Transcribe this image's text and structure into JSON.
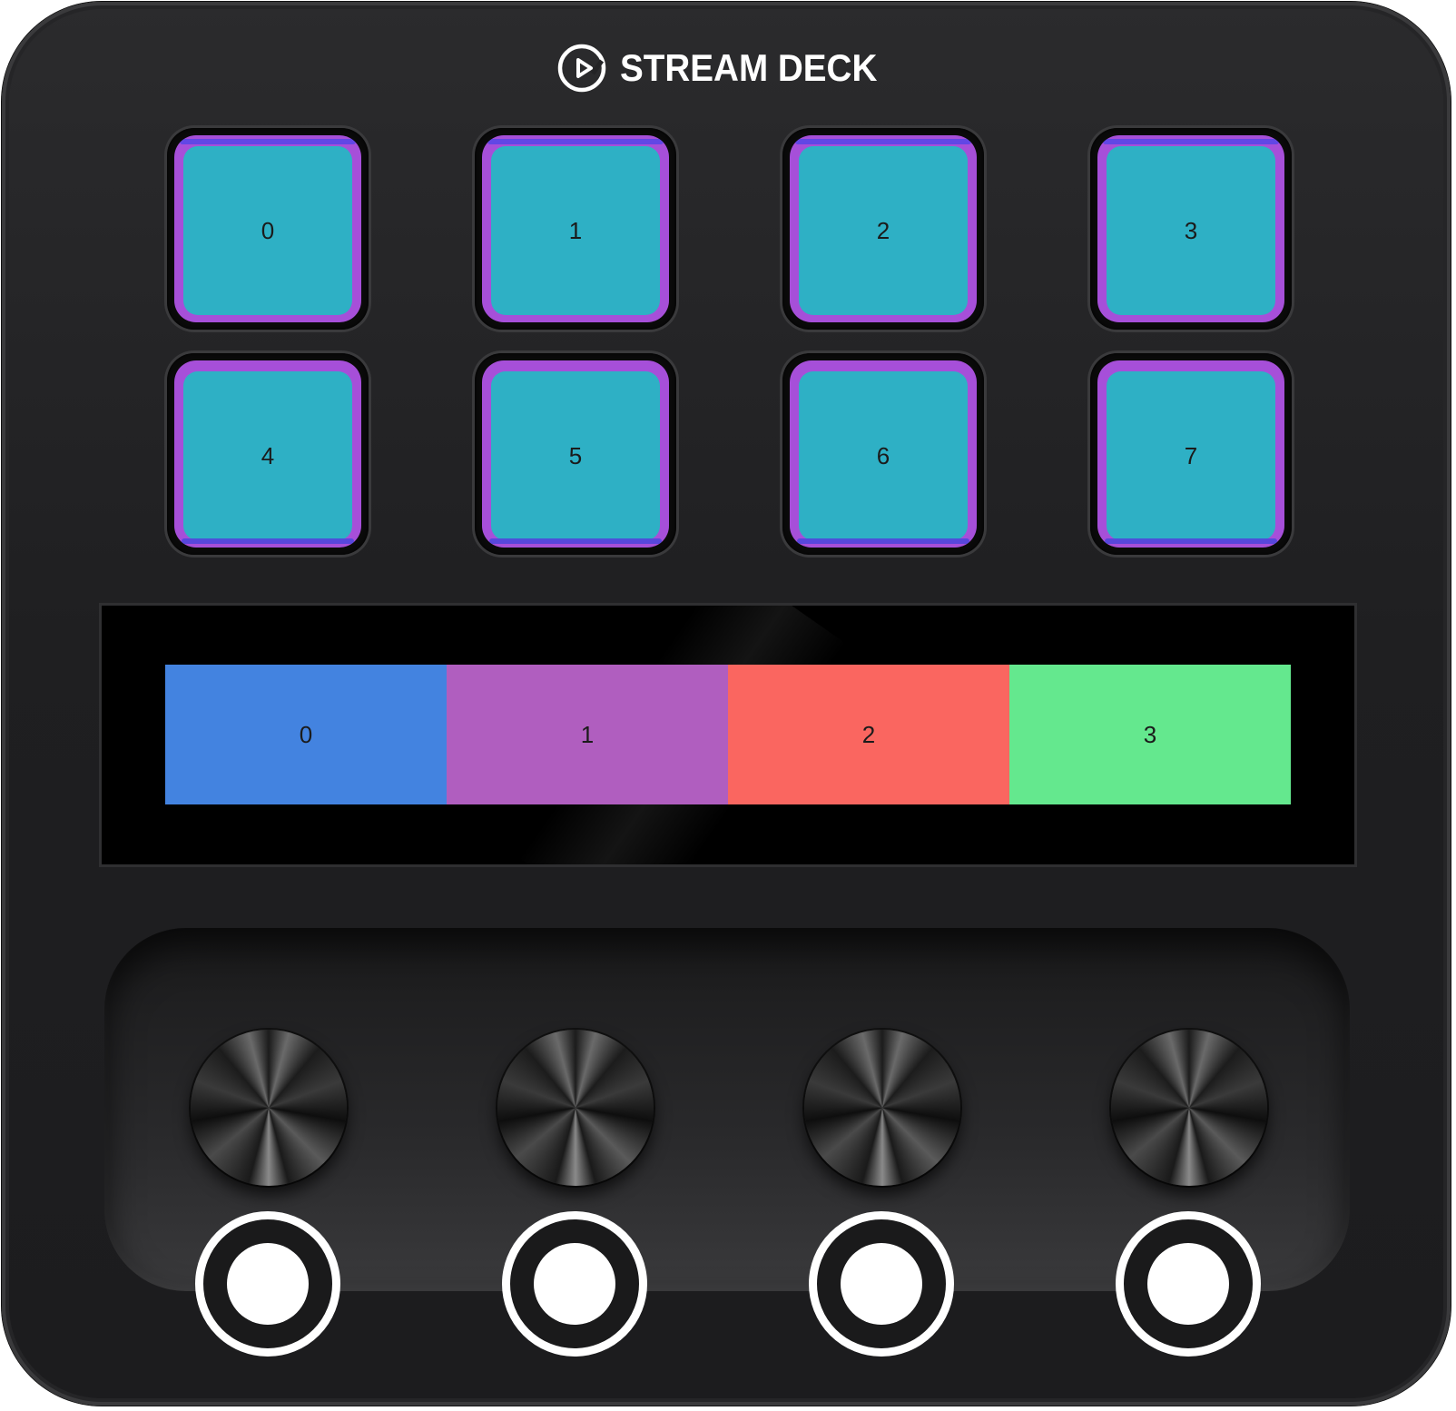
{
  "brand": {
    "name": "STREAM DECK",
    "logo_icon": "elgato-logo-icon"
  },
  "keys": [
    {
      "label": "0"
    },
    {
      "label": "1"
    },
    {
      "label": "2"
    },
    {
      "label": "3"
    },
    {
      "label": "4"
    },
    {
      "label": "5"
    },
    {
      "label": "6"
    },
    {
      "label": "7"
    }
  ],
  "key_colors": {
    "face": "#2eb0c5",
    "border": "#a64fd9",
    "accent": "#5a46e6"
  },
  "touch_strip": {
    "segments": [
      {
        "label": "0",
        "color": "#4383e0"
      },
      {
        "label": "1",
        "color": "#b05ebf"
      },
      {
        "label": "2",
        "color": "#fa6660"
      },
      {
        "label": "3",
        "color": "#64e88e"
      }
    ]
  },
  "dials": [
    {
      "icon": "dial-knob-icon",
      "indicator_icon": "ring-indicator-icon"
    },
    {
      "icon": "dial-knob-icon",
      "indicator_icon": "ring-indicator-icon"
    },
    {
      "icon": "dial-knob-icon",
      "indicator_icon": "ring-indicator-icon"
    },
    {
      "icon": "dial-knob-icon",
      "indicator_icon": "ring-indicator-icon"
    }
  ]
}
